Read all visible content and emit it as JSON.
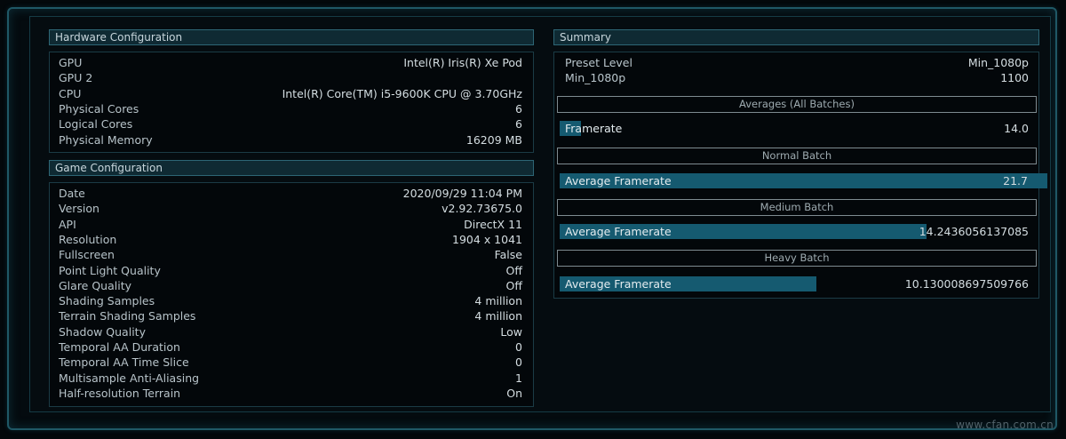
{
  "hardware": {
    "title": "Hardware Configuration",
    "rows": [
      {
        "k": "GPU",
        "v": "Intel(R) Iris(R) Xe Pod"
      },
      {
        "k": "GPU 2",
        "v": ""
      },
      {
        "k": "CPU",
        "v": "Intel(R) Core(TM) i5-9600K CPU @ 3.70GHz"
      },
      {
        "k": "Physical Cores",
        "v": "6"
      },
      {
        "k": "Logical Cores",
        "v": "6"
      },
      {
        "k": "Physical Memory",
        "v": "16209 MB"
      }
    ]
  },
  "game": {
    "title": "Game Configuration",
    "rows": [
      {
        "k": "Date",
        "v": "2020/09/29 11:04 PM"
      },
      {
        "k": "Version",
        "v": "v2.92.73675.0"
      },
      {
        "k": "API",
        "v": "DirectX 11"
      },
      {
        "k": "Resolution",
        "v": "1904 x 1041"
      },
      {
        "k": "Fullscreen",
        "v": "False"
      },
      {
        "k": "Point Light Quality",
        "v": "Off"
      },
      {
        "k": "Glare Quality",
        "v": "Off"
      },
      {
        "k": "Shading Samples",
        "v": "4 million"
      },
      {
        "k": "Terrain Shading Samples",
        "v": "4 million"
      },
      {
        "k": "Shadow Quality",
        "v": "Low"
      },
      {
        "k": "Temporal AA Duration",
        "v": "0"
      },
      {
        "k": "Temporal AA Time Slice",
        "v": "0"
      },
      {
        "k": "Multisample Anti-Aliasing",
        "v": "1"
      },
      {
        "k": "Half-resolution Terrain",
        "v": "On"
      }
    ]
  },
  "summary": {
    "title": "Summary",
    "preset_label": "Preset Level",
    "preset_value": "Min_1080p",
    "score_label": "Min_1080p",
    "score_value": "1100",
    "averages_header": "Averages (All Batches)",
    "averages": {
      "label": "Framerate",
      "value": "14.0",
      "fraction": 0.045
    },
    "normal_header": "Normal Batch",
    "normal": {
      "label": "Average Framerate",
      "value": "21.7",
      "fraction": 1.0
    },
    "medium_header": "Medium Batch",
    "medium": {
      "label": "Average Framerate",
      "value": "14.2436056137085",
      "fraction": 0.77
    },
    "heavy_header": "Heavy Batch",
    "heavy": {
      "label": "Average Framerate",
      "value": "10.130008697509766",
      "fraction": 0.54
    }
  },
  "colors": {
    "accent": "#155a70",
    "border": "#1f5866"
  },
  "watermark": "www.cfan.com.cn"
}
